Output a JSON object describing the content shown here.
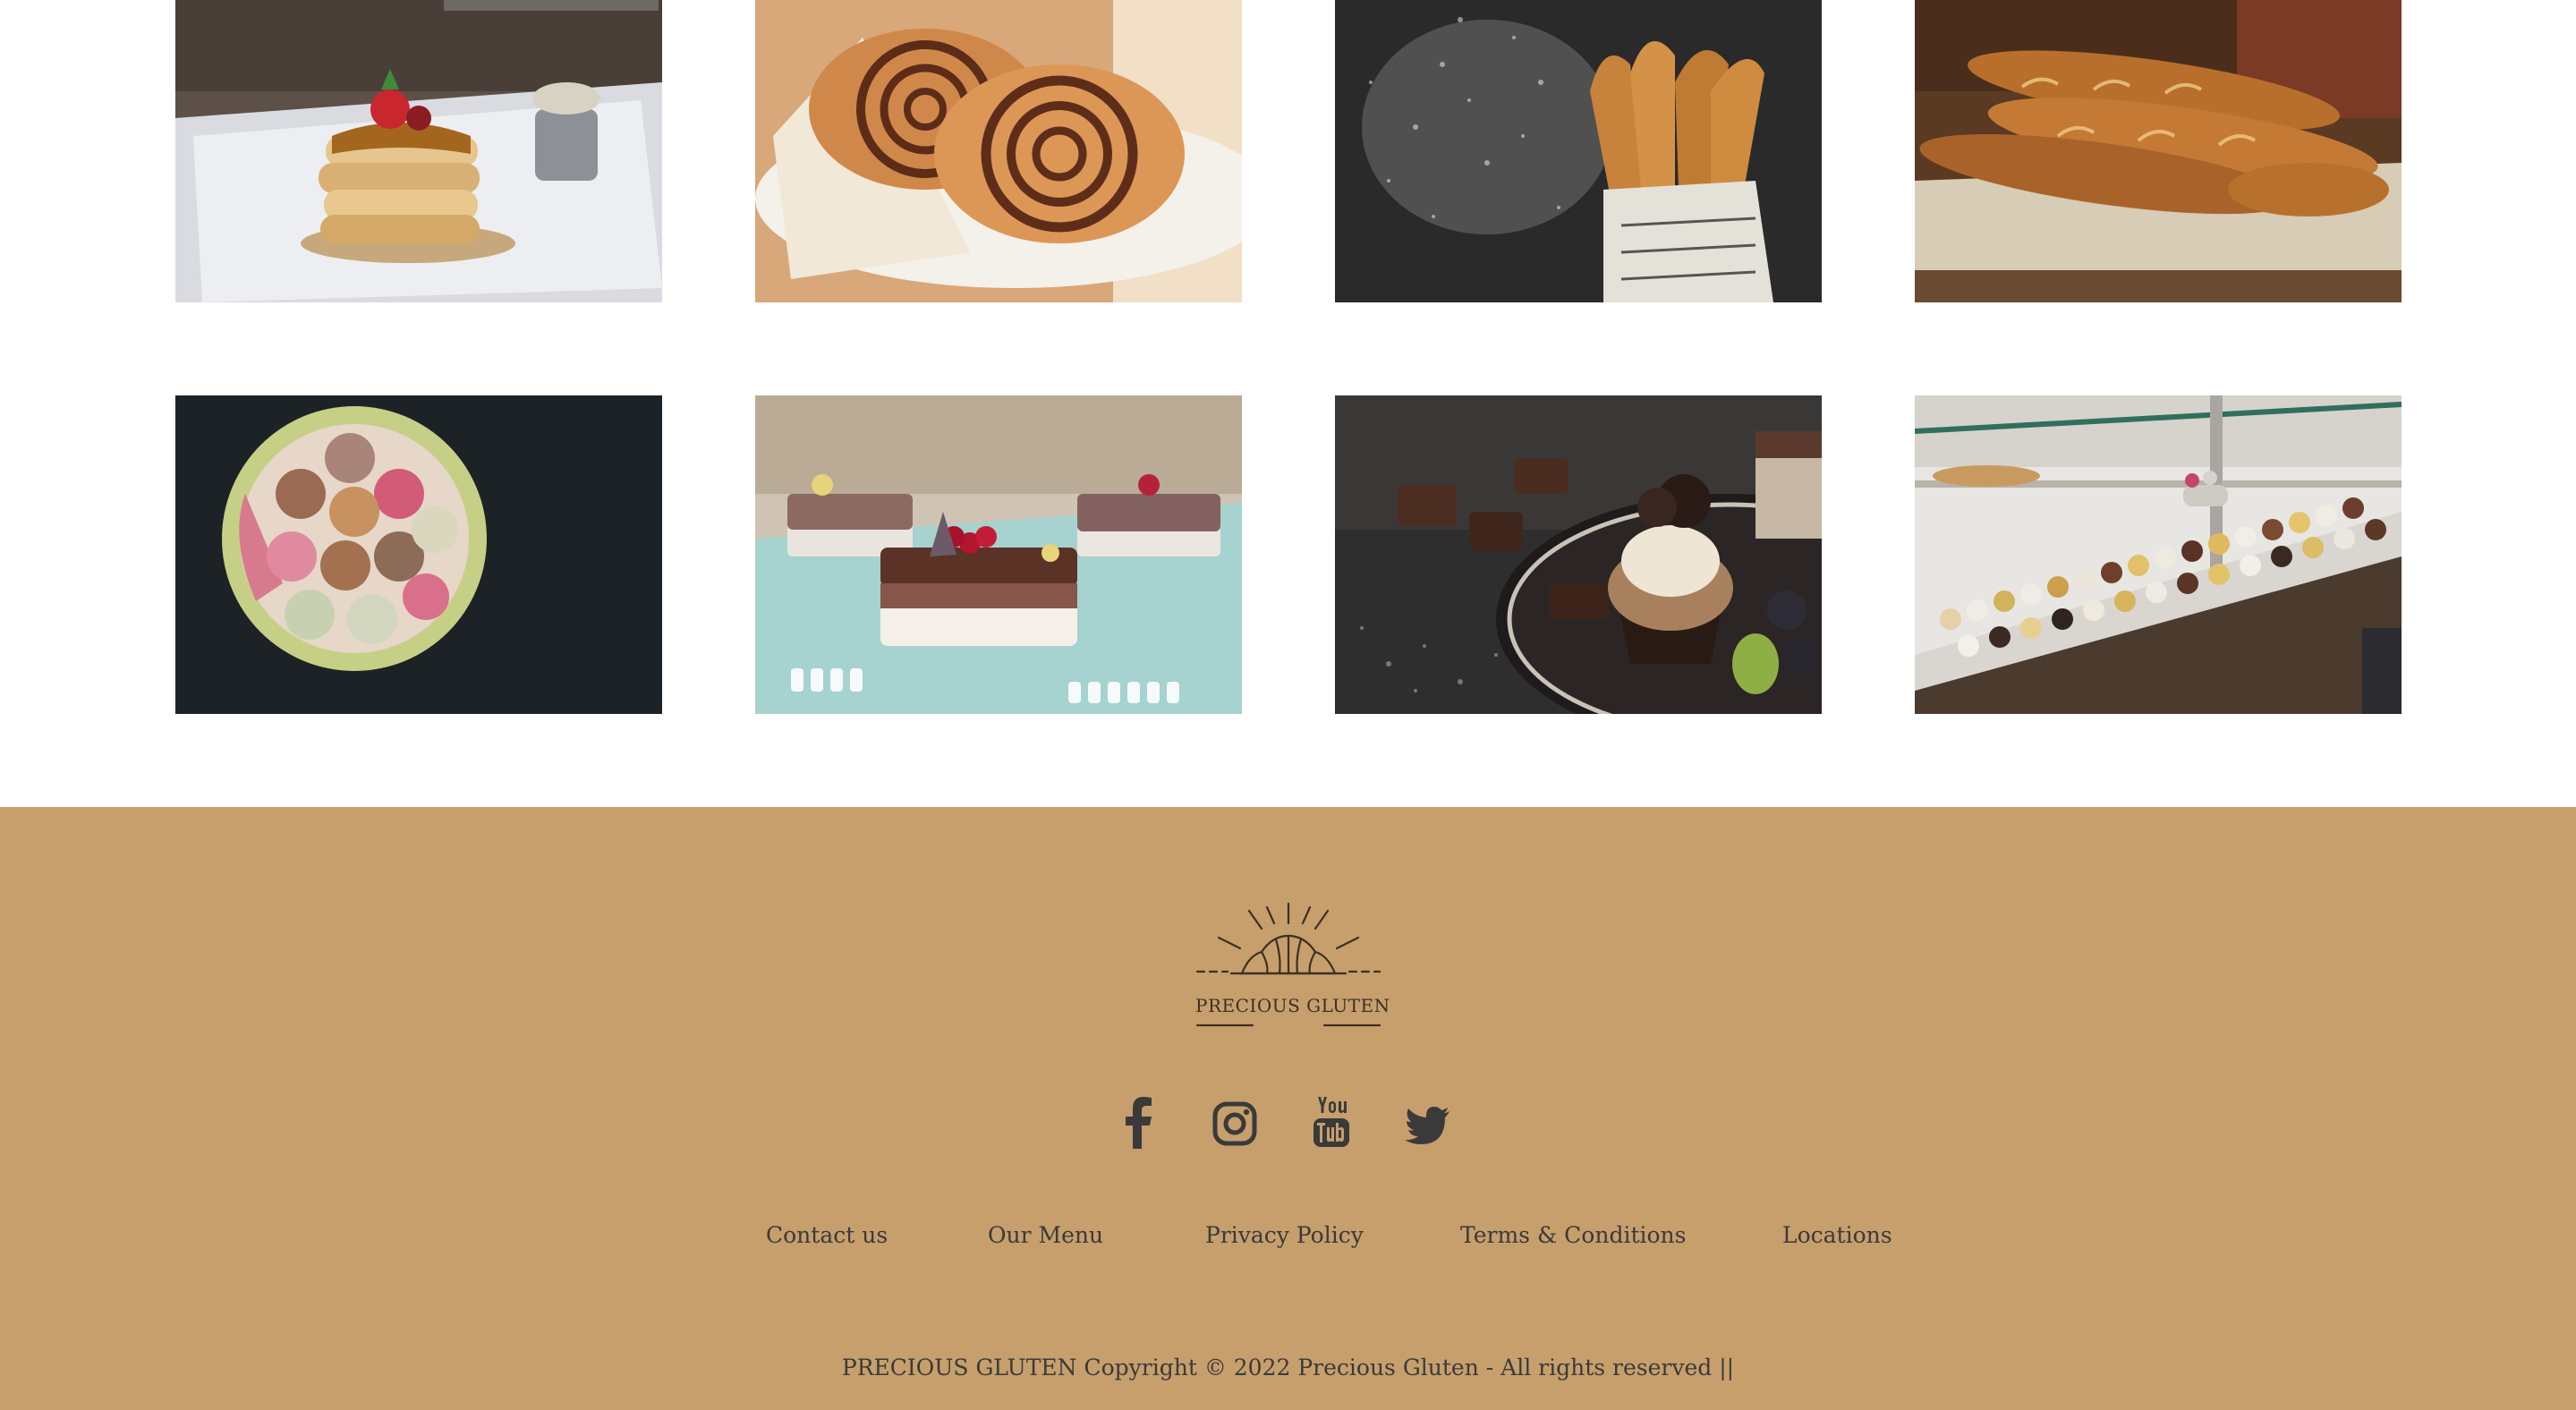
{
  "gallery": {
    "images": [
      {
        "subject": "pancake stack with strawberries and caramel"
      },
      {
        "subject": "cinnamon swirl pastries on a plate"
      },
      {
        "subject": "churros with powdered sugar"
      },
      {
        "subject": "baguettes on linen"
      },
      {
        "subject": "bowl of macarons"
      },
      {
        "subject": "chocolate layer cake slices"
      },
      {
        "subject": "chocolate cupcake on dark plate"
      },
      {
        "subject": "bakery display counter with donuts"
      }
    ]
  },
  "footer": {
    "background": "#c69f6c",
    "logo_text": "PRECIOUS GLUTEN",
    "social": [
      {
        "icon": "facebook-icon"
      },
      {
        "icon": "instagram-icon"
      },
      {
        "icon": "youtube-icon"
      },
      {
        "icon": "twitter-icon"
      }
    ],
    "links": [
      "Contact us",
      "Our Menu",
      "Privacy Policy",
      "Terms & Conditions",
      "Locations"
    ],
    "copyright": "PRECIOUS GLUTEN Copyright © 2022 Precious Gluten - All rights reserved ||"
  }
}
